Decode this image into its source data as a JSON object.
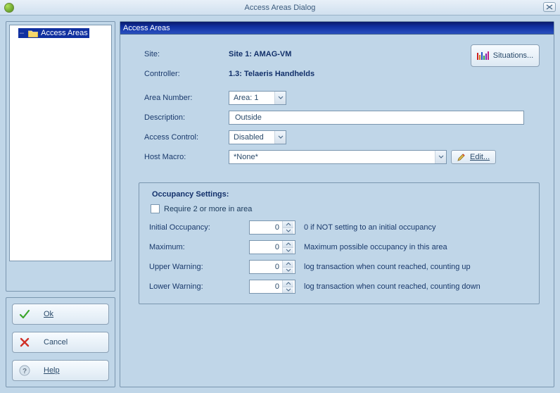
{
  "window": {
    "title": "Access Areas Dialog"
  },
  "tree": {
    "root_label": "Access Areas"
  },
  "buttons": {
    "ok": "Ok",
    "cancel": "Cancel",
    "help": "Help"
  },
  "panel": {
    "header": "Access Areas"
  },
  "form": {
    "site_label": "Site:",
    "site_value": "Site 1: AMAG-VM",
    "controller_label": "Controller:",
    "controller_value": "1.3: Telaeris Handhelds",
    "area_number_label": "Area Number:",
    "area_number_value": "Area: 1",
    "description_label": "Description:",
    "description_value": "Outside",
    "access_control_label": "Access Control:",
    "access_control_value": "Disabled",
    "host_macro_label": "Host Macro:",
    "host_macro_value": "*None*",
    "edit_label": "Edit...",
    "situations_label": "Situations..."
  },
  "occupancy": {
    "legend": "Occupancy Settings:",
    "require_label": "Require 2 or more in area",
    "initial_label": "Initial Occupancy:",
    "initial_value": "0",
    "initial_help": "0 if NOT setting to an initial occupancy",
    "max_label": "Maximum:",
    "max_value": "0",
    "max_help": "Maximum possible occupancy in this area",
    "upper_label": "Upper Warning:",
    "upper_value": "0",
    "upper_help": "log transaction when count reached, counting up",
    "lower_label": "Lower Warning:",
    "lower_value": "0",
    "lower_help": "log transaction when count reached, counting down"
  }
}
